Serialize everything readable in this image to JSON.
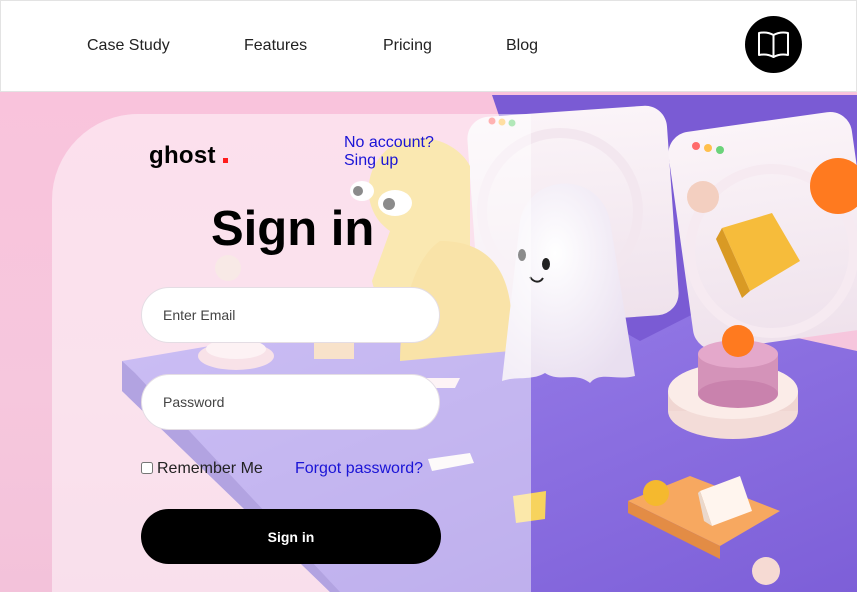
{
  "nav": {
    "links": [
      "Case Study",
      "Features",
      "Pricing",
      "Blog"
    ],
    "menu_icon": "open-book-icon"
  },
  "signin": {
    "brand": "ghost",
    "no_account": "No account?",
    "signup": "Sing up",
    "title": "Sign in",
    "email_placeholder": "Enter Email",
    "password_placeholder": "Password",
    "remember": "Remember Me",
    "forgot": "Forgot password?",
    "submit": "Sign in"
  },
  "colors": {
    "accent_link": "#1a14d6",
    "brand_dot": "#ff1c1c",
    "button": "#000000",
    "background_pink": "#f8c6dc",
    "platform_purple": "#8b6fe0"
  }
}
